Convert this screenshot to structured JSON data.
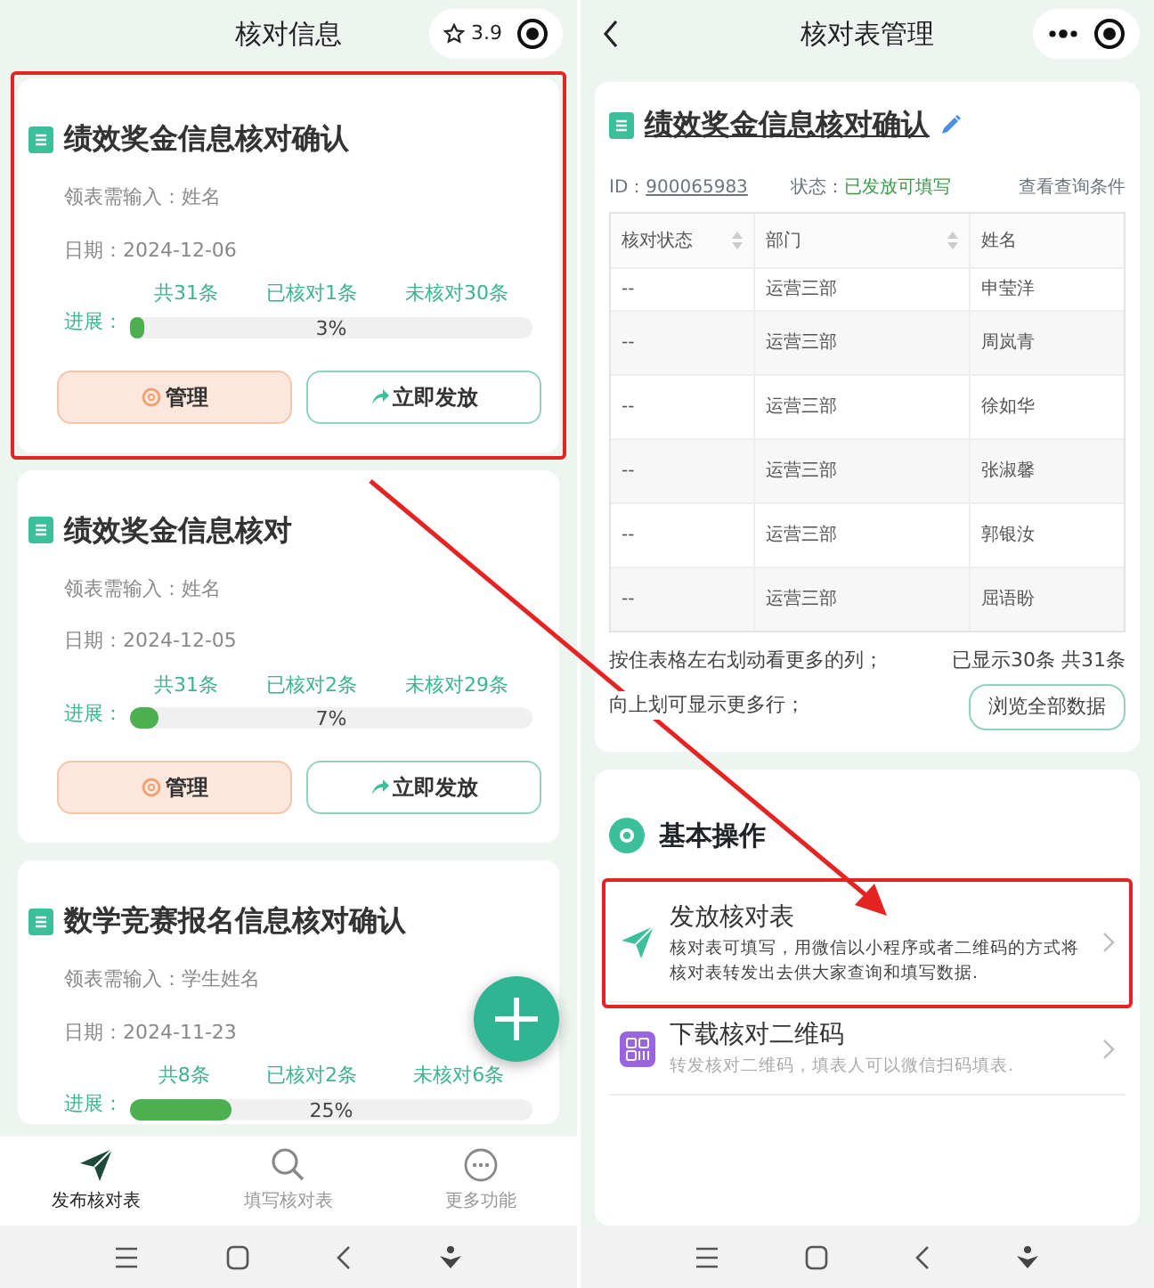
{
  "left_screen": {
    "title": "核对信息",
    "rating": "3.9",
    "cards": [
      {
        "title": "绩效奖金信息核对确认",
        "input_label": "领表需输入：姓名",
        "date": "日期：2024-12-06",
        "progress_label": "进展：",
        "total": "共31条",
        "checked": "已核对1条",
        "unchecked": "未核对30条",
        "level": 0.03,
        "percent": "3%",
        "buttons": [
          "管理",
          "立即发放"
        ],
        "highlighted": true
      },
      {
        "title": "绩效奖金信息核对",
        "input_label": "领表需输入：姓名",
        "date": "日期：2024-12-05",
        "progress_label": "进展：",
        "total": "共31条",
        "checked": "已核对2条",
        "unchecked": "未核对29条",
        "level": 0.07,
        "percent": "7%",
        "buttons": [
          "管理",
          "立即发放"
        ],
        "highlighted": false
      },
      {
        "title": "数学竞赛报名信息核对确认",
        "input_label": "领表需输入：学生姓名",
        "date": "日期：2024-11-23",
        "progress_label": "进展：",
        "total": "共8条",
        "checked": "已核对2条",
        "unchecked": "未核对6条",
        "level": 0.25,
        "percent": "25%",
        "highlighted": false
      }
    ],
    "tabs": [
      {
        "label": "发布核对表",
        "selected": true,
        "kind": "send"
      },
      {
        "label": "填写核对表",
        "selected": false,
        "kind": "search"
      },
      {
        "label": "更多功能",
        "selected": false,
        "kind": "more"
      }
    ]
  },
  "right_screen": {
    "title": "核对表管理",
    "sheet_title": "绩效奖金信息核对确认",
    "id_label": "ID：",
    "id": "900065983",
    "status_label": "状态：",
    "status": "已发放可填写",
    "query_link": "查看查询条件",
    "table": {
      "columns": [
        "核对状态",
        "部门",
        "姓名"
      ],
      "rows": [
        [
          "--",
          "运营三部",
          "申莹洋"
        ],
        [
          "--",
          "运营三部",
          "周岚青"
        ],
        [
          "--",
          "运营三部",
          "徐如华"
        ],
        [
          "--",
          "运营三部",
          "张淑馨"
        ],
        [
          "--",
          "运营三部",
          "郭银汝"
        ],
        [
          "--",
          "运营三部",
          "屈语盼"
        ]
      ]
    },
    "hint_lines": [
      "按住表格左右划动看更多的列；",
      "向上划可显示更多行；"
    ],
    "count": "已显示30条 共31条",
    "browse_button": "浏览全部数据",
    "section_title": "基本操作",
    "actions": [
      {
        "kind": "send",
        "title": "发放核对表",
        "description": "核对表可填写，用微信以小程序或者二维码的方式将核对表转发出去供大家查询和填写数据.",
        "highlighted": true
      },
      {
        "kind": "qr",
        "title": "下载核对二维码",
        "description": "转发核对二维码，填表人可以微信扫码填表.",
        "highlighted": false
      }
    ]
  },
  "annotation_arrow": true
}
